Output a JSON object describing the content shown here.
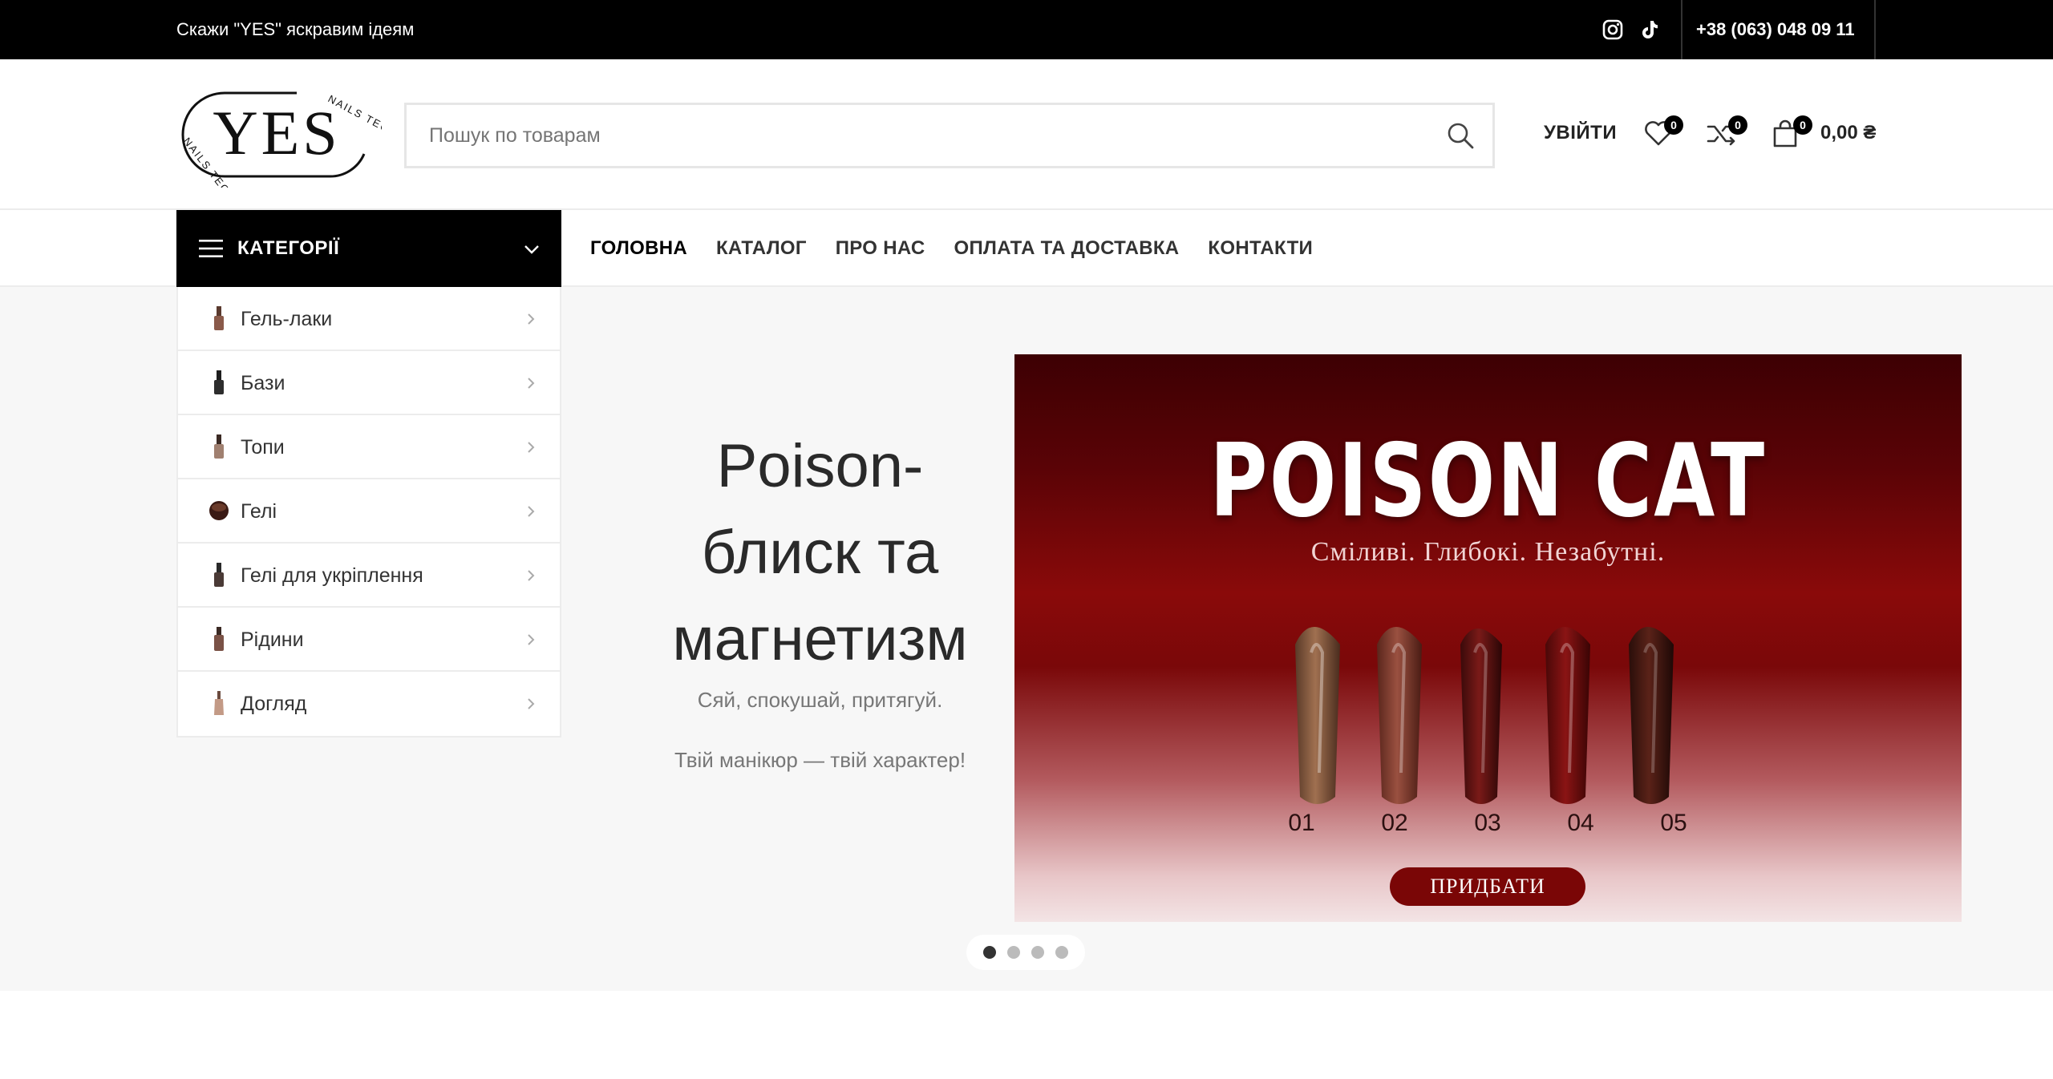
{
  "topbar": {
    "promo": "Скажи \"YES\" яскравим ідеям",
    "phone": "+38 (063) 048 09 11",
    "socials": [
      "instagram-icon",
      "tiktok-icon"
    ]
  },
  "logo": {
    "text": "YES",
    "tagline": "NAILS TECH"
  },
  "search": {
    "placeholder": "Пошук по товарам"
  },
  "header": {
    "login_label": "УВІЙТИ",
    "wishlist_count": "0",
    "compare_count": "0",
    "cart_count": "0",
    "cart_total": "0,00 ₴"
  },
  "nav": {
    "categories_label": "КАТЕГОРІЇ",
    "menu": [
      "ГОЛОВНА",
      "КАТАЛОГ",
      "ПРО НАС",
      "ОПЛАТА ТА ДОСТАВКА",
      "КОНТАКТИ"
    ]
  },
  "categories": [
    {
      "label": "Гель-лаки",
      "icon": "nail-polish-icon"
    },
    {
      "label": "Бази",
      "icon": "nail-polish-icon"
    },
    {
      "label": "Топи",
      "icon": "nail-polish-icon"
    },
    {
      "label": "Гелі",
      "icon": "gel-jar-icon"
    },
    {
      "label": "Гелі для укріплення",
      "icon": "nail-polish-icon"
    },
    {
      "label": "Рідини",
      "icon": "bottle-icon"
    },
    {
      "label": "Догляд",
      "icon": "oil-bottle-icon"
    }
  ],
  "hero": {
    "title": "Poison-блиск та магнетизм",
    "subtitle": "Сяй, спокушай, притягуй.",
    "subtitle2": "Твій манікюр — твій характер!"
  },
  "banner": {
    "title": "POISON CAT",
    "subtitle": "Сміливі. Глибокі. Незабутні.",
    "shades": [
      "01",
      "02",
      "03",
      "04",
      "05"
    ],
    "button_label": "ПРИДБАТИ"
  },
  "slider": {
    "total": 4,
    "active": 1
  },
  "colors": {
    "topbar": "#000000",
    "accent": "#7a0606",
    "background": "#f7f7f7"
  }
}
